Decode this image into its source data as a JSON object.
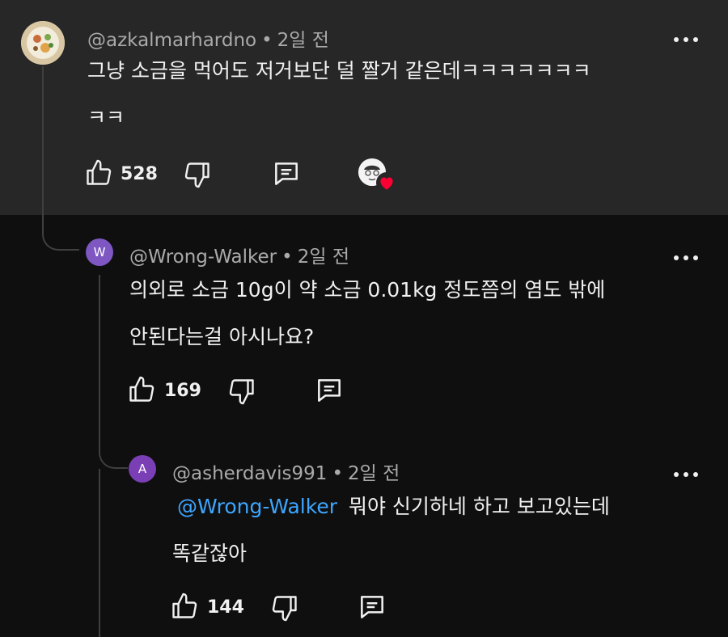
{
  "comments": [
    {
      "author": "@azkalmarhardno",
      "time": "2일 전",
      "lines": [
        "그냥 소금을 먹어도 저거보단 덜 짤거 같은데ㅋㅋㅋㅋㅋㅋㅋ",
        "ㅋㅋ"
      ],
      "likes": "528",
      "avatar_icon": "food-plate-avatar",
      "creator_heart": true
    },
    {
      "author": "@Wrong-Walker",
      "time": "2일 전",
      "avatar_letter": "W",
      "avatar_color": "#7e57c2",
      "lines": [
        "의외로 소금 10g이 약 소금 0.01kg 정도쯤의 염도 밖에",
        "안된다는걸 아시나요?"
      ],
      "likes": "169"
    },
    {
      "author": "@asherdavis991",
      "time": "2일 전",
      "avatar_letter": "A",
      "avatar_color": "#7b3fb5",
      "mention": "@Wrong-Walker",
      "lines": [
        "뭐야 신기하네 하고 보고있는데",
        "똑같잖아"
      ],
      "likes": "144"
    }
  ],
  "separator": "•",
  "colors": {
    "background": "#0f0f0f",
    "highlight": "#272727",
    "mention": "#3ea6ff",
    "heart": "#ff0033"
  }
}
